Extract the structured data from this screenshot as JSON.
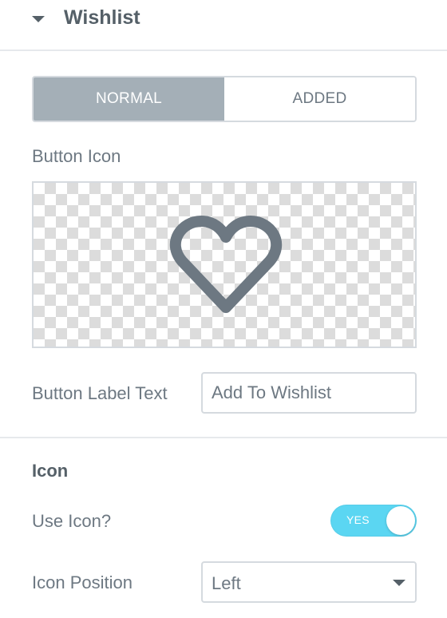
{
  "section": {
    "title": "Wishlist",
    "caret_icon": "caret-down-icon"
  },
  "tabs": [
    {
      "label": "NORMAL",
      "active": true
    },
    {
      "label": "ADDED",
      "active": false
    }
  ],
  "button_icon": {
    "label": "Button Icon",
    "icon": "heart-outline-icon",
    "icon_color": "#6d7882"
  },
  "button_label_text": {
    "label": "Button Label Text",
    "value": "Add To Wishlist"
  },
  "icon_section": {
    "heading": "Icon",
    "use_icon": {
      "label": "Use Icon?",
      "toggle_text": "YES",
      "on": true,
      "color": "#5bd6f2"
    },
    "icon_position": {
      "label": "Icon Position",
      "value": "Left"
    }
  }
}
